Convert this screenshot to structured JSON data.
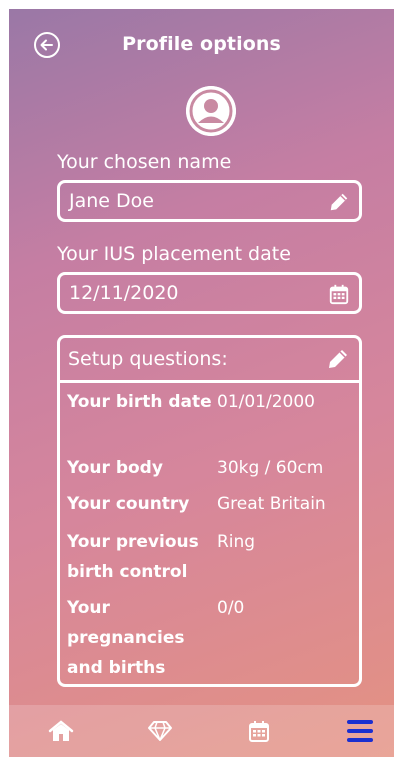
{
  "header": {
    "title": "Profile options",
    "back_icon": "back-arrow-circle-icon"
  },
  "avatar": {
    "icon": "user-circle-icon"
  },
  "name_field": {
    "label": "Your chosen name",
    "value": "Jane Doe",
    "icon": "pencil-icon"
  },
  "date_field": {
    "label": "Your IUS placement date",
    "value": "12/11/2020",
    "icon": "calendar-icon"
  },
  "setup": {
    "title": "Setup questions:",
    "edit_icon": "pencil-icon",
    "rows": [
      {
        "label": "Your birth date",
        "value": "01/01/2000"
      },
      {
        "label": "Your body",
        "value": "30kg / 60cm"
      },
      {
        "label": "Your country",
        "value": "Great Britain"
      },
      {
        "label": "Your previous birth control",
        "value": "Ring"
      },
      {
        "label": "Your pregnancies and births",
        "value": "0/0"
      }
    ]
  },
  "tabbar": {
    "items": [
      {
        "icon": "home-icon"
      },
      {
        "icon": "diamond-icon"
      },
      {
        "icon": "calendar-icon"
      },
      {
        "icon": "menu-icon",
        "active": true
      }
    ],
    "active_color": "#1a2fd0"
  }
}
